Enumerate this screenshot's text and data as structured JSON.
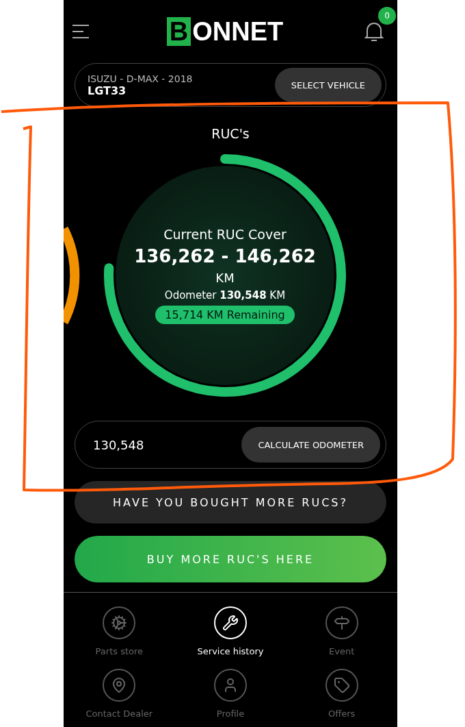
{
  "header": {
    "logo_letter": "B",
    "logo_rest": "ONNET",
    "notifications": "0"
  },
  "vehicle": {
    "make_line": "ISUZU - D-MAX -  2018",
    "plate": "LGT33",
    "button": "SELECT VEHICLE"
  },
  "ruc": {
    "title": "RUC's",
    "cover_label": "Current RUC Cover",
    "range": "136,262 - 146,262",
    "unit": "KM",
    "odometer": "Odometer **130,548** KM",
    "remaining": "15,714 KM Remaining"
  },
  "odometer_entry": {
    "value": "130,548",
    "button": "CALCULATE ODOMETER"
  },
  "buttons": [
    {
      "label": "HAVE YOU BOUGHT MORE RUCS?",
      "kind": "dark"
    },
    {
      "label": "BUY MORE RUC'S HERE",
      "kind": "green"
    }
  ],
  "nav": [
    {
      "label": "Parts store",
      "selected": false
    },
    {
      "label": "Service history",
      "selected": true
    },
    {
      "label": "Event",
      "selected": false
    },
    {
      "label": "Contact Dealer",
      "selected": false
    },
    {
      "label": "Profile",
      "selected": false
    },
    {
      "label": "Offers",
      "selected": false
    }
  ]
}
